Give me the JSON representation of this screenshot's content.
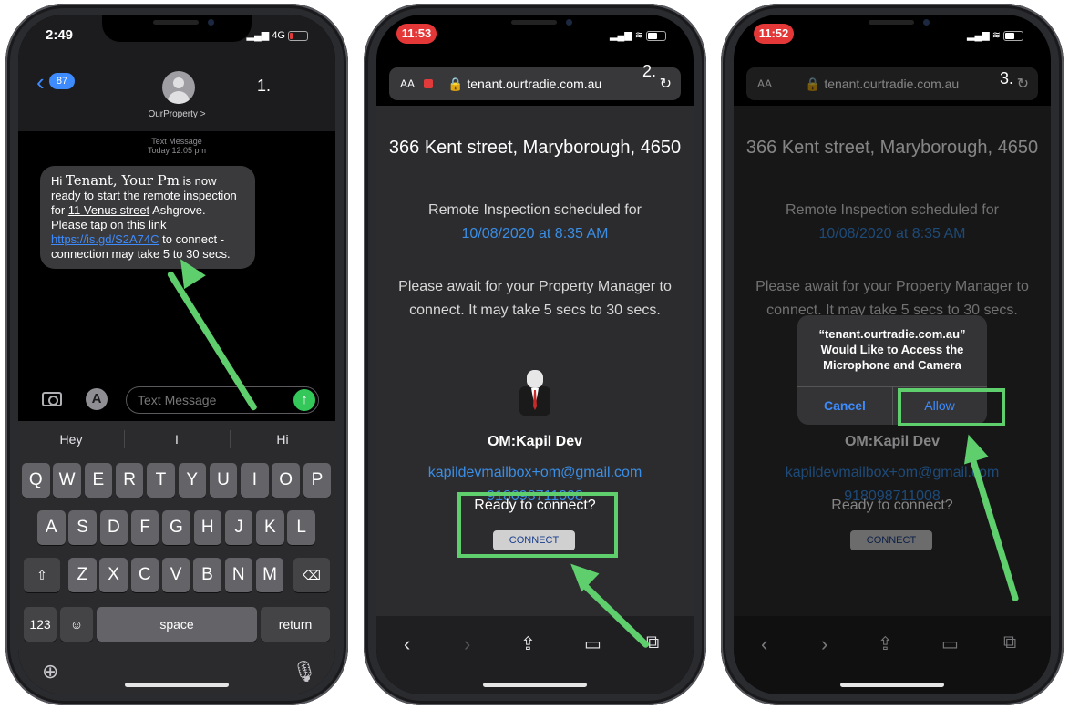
{
  "phone1": {
    "step": "1.",
    "time": "2:49",
    "network": "4G",
    "back_count": "87",
    "contact_name": "OurProperty >",
    "meta_line1": "Text Message",
    "meta_line2": "Today 12:05 pm",
    "msg_hi": "Hi",
    "msg_redacted": "Tenant, Your Pm",
    "msg_is": "is now ready to start the remote inspection for",
    "msg_address": "11 Venus street",
    "msg_mid": "Ashgrove. Please tap on this link",
    "msg_link": "https://is.gd/S2A74C",
    "msg_end": "to connect - connection may take 5 to 30 secs.",
    "input_placeholder": "Text Message",
    "suggestions": [
      "Hey",
      "I",
      "Hi"
    ],
    "row1": [
      "Q",
      "W",
      "E",
      "R",
      "T",
      "Y",
      "U",
      "I",
      "O",
      "P"
    ],
    "row2": [
      "A",
      "S",
      "D",
      "F",
      "G",
      "H",
      "J",
      "K",
      "L"
    ],
    "row3": [
      "Z",
      "X",
      "C",
      "V",
      "B",
      "N",
      "M"
    ],
    "key_123": "123",
    "key_space": "space",
    "key_return": "return"
  },
  "phone2": {
    "step": "2.",
    "time": "11:53",
    "aa": "AA",
    "url": "tenant.ourtradie.com.au",
    "address_title": "366 Kent street, Maryborough, 4650",
    "scheduled_label": "Remote Inspection scheduled for",
    "scheduled_time": "10/08/2020 at 8:35 AM",
    "await_text": "Please await for your Property Manager to connect. It may take 5 secs to 30 secs.",
    "agent_name": "OM:Kapil Dev",
    "agent_email": "kapildevmailbox+om@gmail.com",
    "agent_phone": "918098711008",
    "ready": "Ready to connect?",
    "connect": "CONNECT"
  },
  "phone3": {
    "step": "3.",
    "time": "11:52",
    "aa": "AA",
    "url": "tenant.ourtradie.com.au",
    "address_title": "366 Kent street, Maryborough, 4650",
    "scheduled_label": "Remote Inspection scheduled for",
    "scheduled_time": "10/08/2020 at 8:35 AM",
    "await_text": "Please await for your Property Manager to connect. It may take 5 secs to 30 secs.",
    "agent_name": "OM:Kapil Dev",
    "agent_email": "kapildevmailbox+om@gmail.com",
    "agent_phone": "918098711008",
    "ready": "Ready to connect?",
    "connect": "CONNECT",
    "alert_title": "“tenant.ourtradie.com.au” Would Like to Access the Microphone and Camera",
    "alert_cancel": "Cancel",
    "alert_allow": "Allow"
  },
  "colors": {
    "highlight": "#5ecf6c",
    "link": "#3a8ee6",
    "ios_blue": "#3d8bfd",
    "record_red": "#e03a3a"
  }
}
